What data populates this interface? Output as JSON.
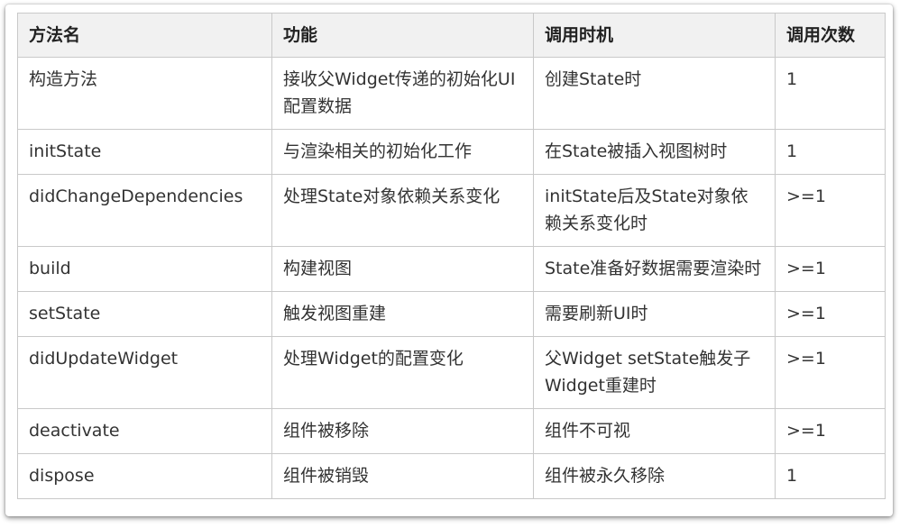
{
  "table": {
    "headers": [
      "方法名",
      "功能",
      "调用时机",
      "调用次数"
    ],
    "rows": [
      [
        "构造方法",
        "接收父Widget传递的初始化UI配置数据",
        "创建State时",
        "1"
      ],
      [
        "initState",
        "与渲染相关的初始化工作",
        "在State被插入视图树时",
        "1"
      ],
      [
        "didChangeDependencies",
        "处理State对象依赖关系变化",
        "initState后及State对象依赖关系变化时",
        ">=1"
      ],
      [
        "build",
        "构建视图",
        "State准备好数据需要渲染时",
        ">=1"
      ],
      [
        "setState",
        "触发视图重建",
        "需要刷新UI时",
        ">=1"
      ],
      [
        "didUpdateWidget",
        "处理Widget的配置变化",
        "父Widget setState触发子Widget重建时",
        ">=1"
      ],
      [
        "deactivate",
        "组件被移除",
        "组件不可视",
        ">=1"
      ],
      [
        "dispose",
        "组件被销毁",
        "组件被永久移除",
        "1"
      ]
    ]
  }
}
